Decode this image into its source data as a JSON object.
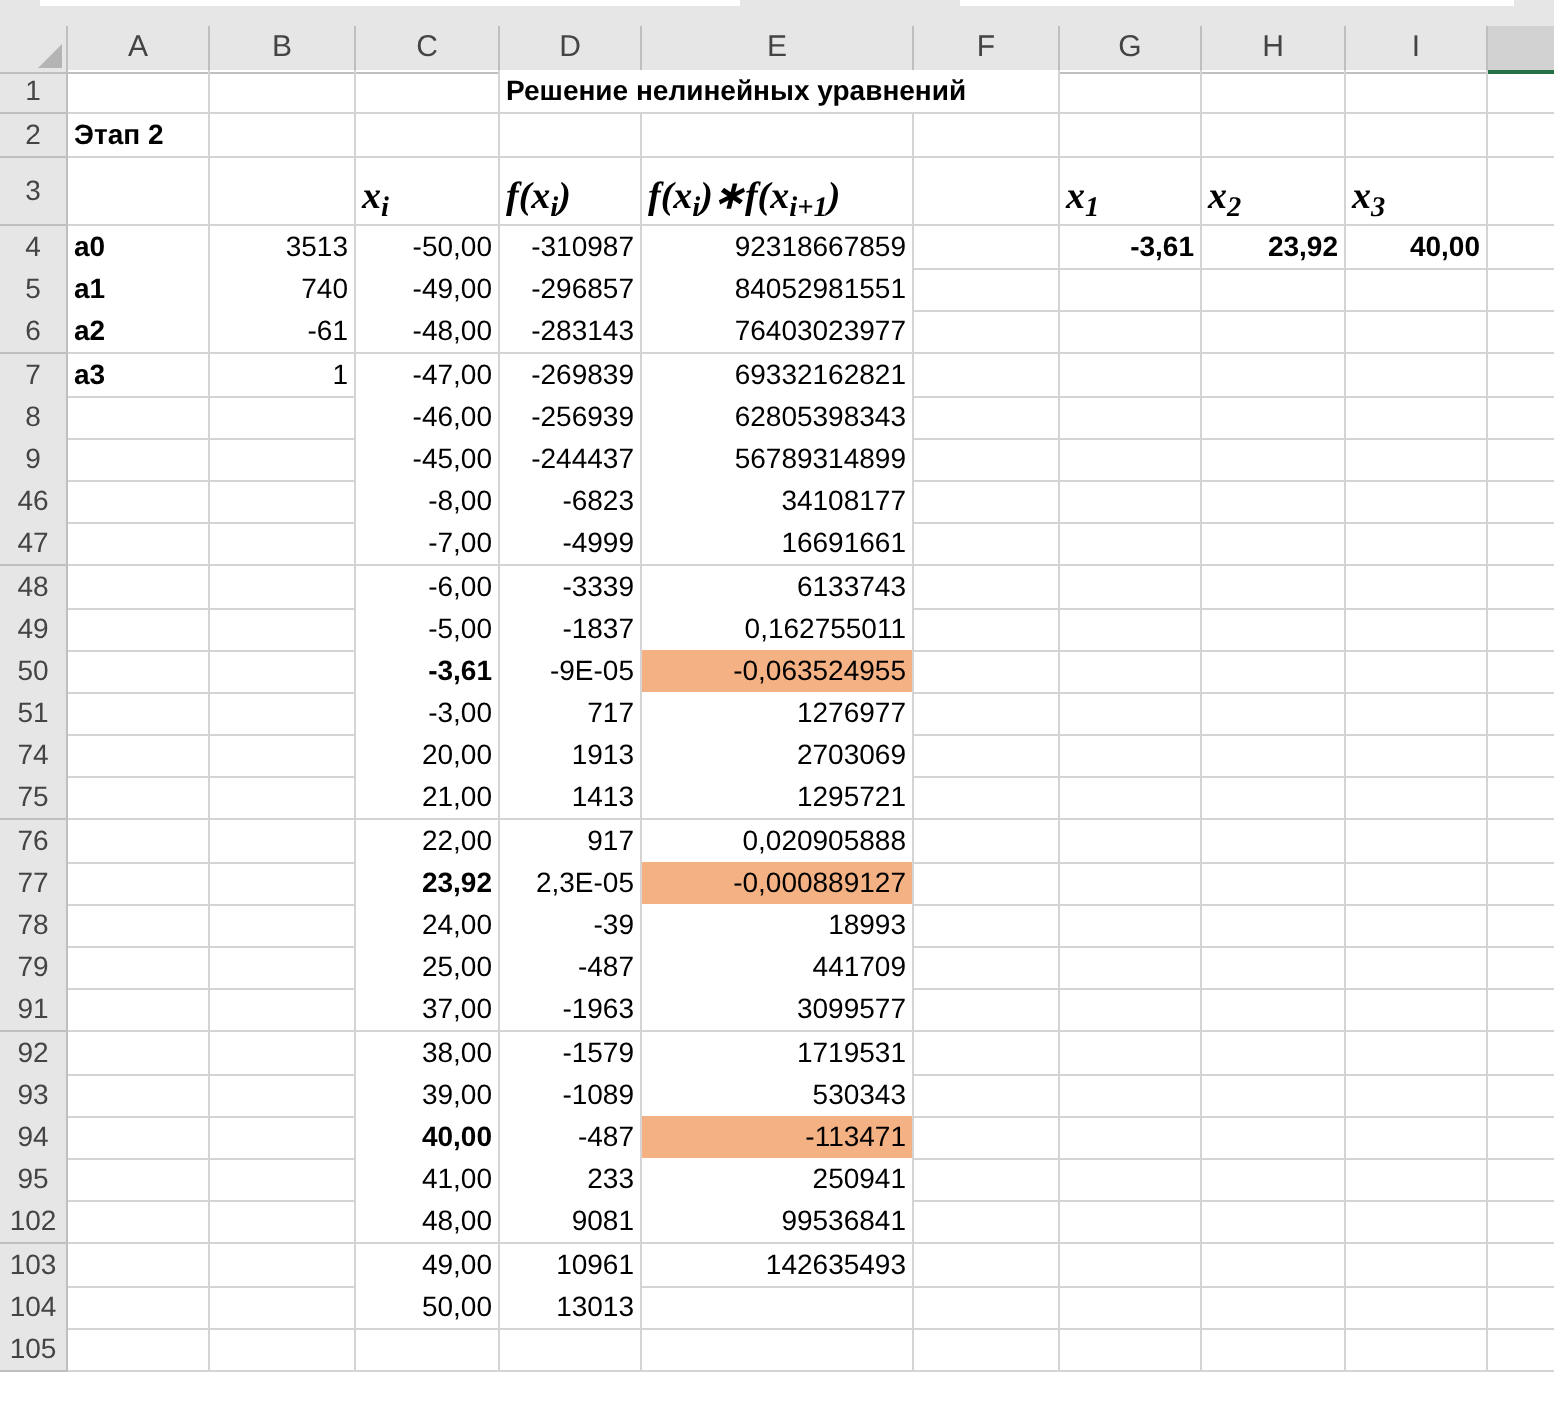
{
  "columns": [
    "A",
    "B",
    "C",
    "D",
    "E",
    "F",
    "G",
    "H",
    "I"
  ],
  "rows": [
    {
      "number": "1",
      "cells": {
        "D": {
          "text": "Решение нелинейных уравнений",
          "kind": "title",
          "bold": true,
          "highlighted": false
        }
      }
    },
    {
      "number": "2",
      "cells": {
        "A": {
          "text": "Этап 2",
          "kind": "label",
          "bold": true,
          "highlighted": false
        }
      }
    },
    {
      "number": "3",
      "cells": {
        "C": {
          "text": "x$_{i}$",
          "kind": "formula",
          "bold": true,
          "highlighted": false
        },
        "D": {
          "text": "f(x$_{i}$)",
          "kind": "formula",
          "bold": true,
          "highlighted": false
        },
        "E": {
          "text": "f(x$_{i}$)∗f(x$_{i+1}$)",
          "kind": "formula",
          "bold": true,
          "highlighted": false
        },
        "G": {
          "text": "x$_{1}$",
          "kind": "formula",
          "bold": true,
          "highlighted": false
        },
        "H": {
          "text": "x$_{2}$",
          "kind": "formula",
          "bold": true,
          "highlighted": false
        },
        "I": {
          "text": "x$_{3}$",
          "kind": "formula",
          "bold": true,
          "highlighted": false
        }
      }
    },
    {
      "number": "4",
      "cells": {
        "A": {
          "text": "a0",
          "kind": "label",
          "bold": true,
          "highlighted": false
        },
        "B": {
          "text": "3513",
          "kind": "number",
          "bold": false,
          "highlighted": false
        },
        "C": {
          "text": "-50,00",
          "kind": "number",
          "bold": false,
          "highlighted": false
        },
        "D": {
          "text": "-310987",
          "kind": "number",
          "bold": false,
          "highlighted": false
        },
        "E": {
          "text": "92318667859",
          "kind": "number",
          "bold": false,
          "highlighted": false
        },
        "G": {
          "text": "-3,61",
          "kind": "number",
          "bold": true,
          "highlighted": false
        },
        "H": {
          "text": "23,92",
          "kind": "number",
          "bold": true,
          "highlighted": false
        },
        "I": {
          "text": "40,00",
          "kind": "number",
          "bold": true,
          "highlighted": false
        }
      }
    },
    {
      "number": "5",
      "cells": {
        "A": {
          "text": "a1",
          "kind": "label",
          "bold": true,
          "highlighted": false
        },
        "B": {
          "text": "740",
          "kind": "number",
          "bold": false,
          "highlighted": false
        },
        "C": {
          "text": "-49,00",
          "kind": "number",
          "bold": false,
          "highlighted": false
        },
        "D": {
          "text": "-296857",
          "kind": "number",
          "bold": false,
          "highlighted": false
        },
        "E": {
          "text": "84052981551",
          "kind": "number",
          "bold": false,
          "highlighted": false
        }
      }
    },
    {
      "number": "6",
      "cells": {
        "A": {
          "text": "a2",
          "kind": "label",
          "bold": true,
          "highlighted": false
        },
        "B": {
          "text": "-61",
          "kind": "number",
          "bold": false,
          "highlighted": false
        },
        "C": {
          "text": "-48,00",
          "kind": "number",
          "bold": false,
          "highlighted": false
        },
        "D": {
          "text": "-283143",
          "kind": "number",
          "bold": false,
          "highlighted": false
        },
        "E": {
          "text": "76403023977",
          "kind": "number",
          "bold": false,
          "highlighted": false
        }
      }
    },
    {
      "number": "7",
      "cells": {
        "A": {
          "text": "a3",
          "kind": "label",
          "bold": true,
          "highlighted": false
        },
        "B": {
          "text": "1",
          "kind": "number",
          "bold": false,
          "highlighted": false
        },
        "C": {
          "text": "-47,00",
          "kind": "number",
          "bold": false,
          "highlighted": false
        },
        "D": {
          "text": "-269839",
          "kind": "number",
          "bold": false,
          "highlighted": false
        },
        "E": {
          "text": "69332162821",
          "kind": "number",
          "bold": false,
          "highlighted": false
        }
      }
    },
    {
      "number": "8",
      "cells": {
        "C": {
          "text": "-46,00",
          "kind": "number",
          "bold": false,
          "highlighted": false
        },
        "D": {
          "text": "-256939",
          "kind": "number",
          "bold": false,
          "highlighted": false
        },
        "E": {
          "text": "62805398343",
          "kind": "number",
          "bold": false,
          "highlighted": false
        }
      }
    },
    {
      "number": "9",
      "cells": {
        "C": {
          "text": "-45,00",
          "kind": "number",
          "bold": false,
          "highlighted": false
        },
        "D": {
          "text": "-244437",
          "kind": "number",
          "bold": false,
          "highlighted": false
        },
        "E": {
          "text": "56789314899",
          "kind": "number",
          "bold": false,
          "highlighted": false
        }
      }
    },
    {
      "number": "46",
      "cells": {
        "C": {
          "text": "-8,00",
          "kind": "number",
          "bold": false,
          "highlighted": false
        },
        "D": {
          "text": "-6823",
          "kind": "number",
          "bold": false,
          "highlighted": false
        },
        "E": {
          "text": "34108177",
          "kind": "number",
          "bold": false,
          "highlighted": false
        }
      }
    },
    {
      "number": "47",
      "cells": {
        "C": {
          "text": "-7,00",
          "kind": "number",
          "bold": false,
          "highlighted": false
        },
        "D": {
          "text": "-4999",
          "kind": "number",
          "bold": false,
          "highlighted": false
        },
        "E": {
          "text": "16691661",
          "kind": "number",
          "bold": false,
          "highlighted": false
        }
      }
    },
    {
      "number": "48",
      "cells": {
        "C": {
          "text": "-6,00",
          "kind": "number",
          "bold": false,
          "highlighted": false
        },
        "D": {
          "text": "-3339",
          "kind": "number",
          "bold": false,
          "highlighted": false
        },
        "E": {
          "text": "6133743",
          "kind": "number",
          "bold": false,
          "highlighted": false
        }
      }
    },
    {
      "number": "49",
      "cells": {
        "C": {
          "text": "-5,00",
          "kind": "number",
          "bold": false,
          "highlighted": false
        },
        "D": {
          "text": "-1837",
          "kind": "number",
          "bold": false,
          "highlighted": false
        },
        "E": {
          "text": "0,162755011",
          "kind": "number",
          "bold": false,
          "highlighted": false
        }
      }
    },
    {
      "number": "50",
      "cells": {
        "C": {
          "text": "-3,61",
          "kind": "number",
          "bold": true,
          "highlighted": false
        },
        "D": {
          "text": "-9E-05",
          "kind": "number",
          "bold": false,
          "highlighted": false
        },
        "E": {
          "text": "-0,063524955",
          "kind": "number",
          "bold": false,
          "highlighted": true
        }
      }
    },
    {
      "number": "51",
      "cells": {
        "C": {
          "text": "-3,00",
          "kind": "number",
          "bold": false,
          "highlighted": false
        },
        "D": {
          "text": "717",
          "kind": "number",
          "bold": false,
          "highlighted": false
        },
        "E": {
          "text": "1276977",
          "kind": "number",
          "bold": false,
          "highlighted": false
        }
      }
    },
    {
      "number": "74",
      "cells": {
        "C": {
          "text": "20,00",
          "kind": "number",
          "bold": false,
          "highlighted": false
        },
        "D": {
          "text": "1913",
          "kind": "number",
          "bold": false,
          "highlighted": false
        },
        "E": {
          "text": "2703069",
          "kind": "number",
          "bold": false,
          "highlighted": false
        }
      }
    },
    {
      "number": "75",
      "cells": {
        "C": {
          "text": "21,00",
          "kind": "number",
          "bold": false,
          "highlighted": false
        },
        "D": {
          "text": "1413",
          "kind": "number",
          "bold": false,
          "highlighted": false
        },
        "E": {
          "text": "1295721",
          "kind": "number",
          "bold": false,
          "highlighted": false
        }
      }
    },
    {
      "number": "76",
      "cells": {
        "C": {
          "text": "22,00",
          "kind": "number",
          "bold": false,
          "highlighted": false
        },
        "D": {
          "text": "917",
          "kind": "number",
          "bold": false,
          "highlighted": false
        },
        "E": {
          "text": "0,020905888",
          "kind": "number",
          "bold": false,
          "highlighted": false
        }
      }
    },
    {
      "number": "77",
      "cells": {
        "C": {
          "text": "23,92",
          "kind": "number",
          "bold": true,
          "highlighted": false
        },
        "D": {
          "text": "2,3E-05",
          "kind": "number",
          "bold": false,
          "highlighted": false
        },
        "E": {
          "text": "-0,000889127",
          "kind": "number",
          "bold": false,
          "highlighted": true
        }
      }
    },
    {
      "number": "78",
      "cells": {
        "C": {
          "text": "24,00",
          "kind": "number",
          "bold": false,
          "highlighted": false
        },
        "D": {
          "text": "-39",
          "kind": "number",
          "bold": false,
          "highlighted": false
        },
        "E": {
          "text": "18993",
          "kind": "number",
          "bold": false,
          "highlighted": false
        }
      }
    },
    {
      "number": "79",
      "cells": {
        "C": {
          "text": "25,00",
          "kind": "number",
          "bold": false,
          "highlighted": false
        },
        "D": {
          "text": "-487",
          "kind": "number",
          "bold": false,
          "highlighted": false
        },
        "E": {
          "text": "441709",
          "kind": "number",
          "bold": false,
          "highlighted": false
        }
      }
    },
    {
      "number": "91",
      "cells": {
        "C": {
          "text": "37,00",
          "kind": "number",
          "bold": false,
          "highlighted": false
        },
        "D": {
          "text": "-1963",
          "kind": "number",
          "bold": false,
          "highlighted": false
        },
        "E": {
          "text": "3099577",
          "kind": "number",
          "bold": false,
          "highlighted": false
        }
      }
    },
    {
      "number": "92",
      "cells": {
        "C": {
          "text": "38,00",
          "kind": "number",
          "bold": false,
          "highlighted": false
        },
        "D": {
          "text": "-1579",
          "kind": "number",
          "bold": false,
          "highlighted": false
        },
        "E": {
          "text": "1719531",
          "kind": "number",
          "bold": false,
          "highlighted": false
        }
      }
    },
    {
      "number": "93",
      "cells": {
        "C": {
          "text": "39,00",
          "kind": "number",
          "bold": false,
          "highlighted": false
        },
        "D": {
          "text": "-1089",
          "kind": "number",
          "bold": false,
          "highlighted": false
        },
        "E": {
          "text": "530343",
          "kind": "number",
          "bold": false,
          "highlighted": false
        }
      }
    },
    {
      "number": "94",
      "cells": {
        "C": {
          "text": "40,00",
          "kind": "number",
          "bold": true,
          "highlighted": false
        },
        "D": {
          "text": "-487",
          "kind": "number",
          "bold": false,
          "highlighted": false
        },
        "E": {
          "text": "-113471",
          "kind": "number",
          "bold": false,
          "highlighted": true
        }
      }
    },
    {
      "number": "95",
      "cells": {
        "C": {
          "text": "41,00",
          "kind": "number",
          "bold": false,
          "highlighted": false
        },
        "D": {
          "text": "233",
          "kind": "number",
          "bold": false,
          "highlighted": false
        },
        "E": {
          "text": "250941",
          "kind": "number",
          "bold": false,
          "highlighted": false
        }
      }
    },
    {
      "number": "102",
      "cells": {
        "C": {
          "text": "48,00",
          "kind": "number",
          "bold": false,
          "highlighted": false
        },
        "D": {
          "text": "9081",
          "kind": "number",
          "bold": false,
          "highlighted": false
        },
        "E": {
          "text": "99536841",
          "kind": "number",
          "bold": false,
          "highlighted": false
        }
      }
    },
    {
      "number": "103",
      "cells": {
        "C": {
          "text": "49,00",
          "kind": "number",
          "bold": false,
          "highlighted": false
        },
        "D": {
          "text": "10961",
          "kind": "number",
          "bold": false,
          "highlighted": false
        },
        "E": {
          "text": "142635493",
          "kind": "number",
          "bold": false,
          "highlighted": false
        }
      }
    },
    {
      "number": "104",
      "cells": {
        "C": {
          "text": "50,00",
          "kind": "number",
          "bold": false,
          "highlighted": false
        },
        "D": {
          "text": "13013",
          "kind": "number",
          "bold": false,
          "highlighted": false
        }
      }
    },
    {
      "number": "105",
      "cells": {}
    }
  ]
}
